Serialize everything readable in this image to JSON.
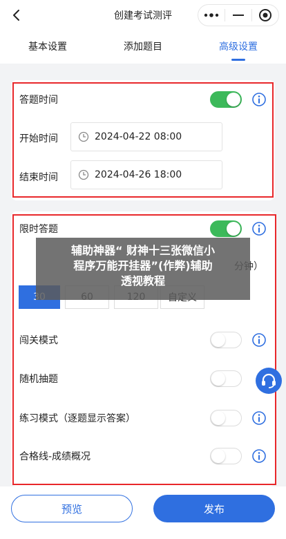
{
  "header": {
    "title": "创建考试测评"
  },
  "tabs": [
    {
      "label": "基本设置",
      "active": false
    },
    {
      "label": "添加题目",
      "active": false
    },
    {
      "label": "高级设置",
      "active": true
    }
  ],
  "section_time": {
    "toggle_label": "答题时间",
    "toggle_on": true,
    "start_label": "开始时间",
    "start_value": "2024-04-22 08:00",
    "end_label": "结束时间",
    "end_value": "2024-04-26 18:00"
  },
  "section_limit": {
    "toggle_label": "限时答题",
    "toggle_on": true,
    "partial_text": "分钟）",
    "durations": [
      "30",
      "60",
      "120",
      "自定义"
    ],
    "selected_duration": "30",
    "options": [
      {
        "label": "闯关模式",
        "on": false
      },
      {
        "label": "随机抽题",
        "on": false
      },
      {
        "label": "练习模式（逐题显示答案）",
        "on": false
      },
      {
        "label": "合格线-成绩概况",
        "on": false
      }
    ]
  },
  "overlay": {
    "line1": "辅助神器“ 财神十三张微信小",
    "line2": "程序万能开挂器”(作弊)辅助",
    "line3": "透视教程"
  },
  "footer": {
    "preview_label": "预览",
    "publish_label": "发布"
  },
  "colors": {
    "accent": "#2f6fe0",
    "toggle_on": "#3cb95a",
    "highlight_border": "#e8272a"
  }
}
